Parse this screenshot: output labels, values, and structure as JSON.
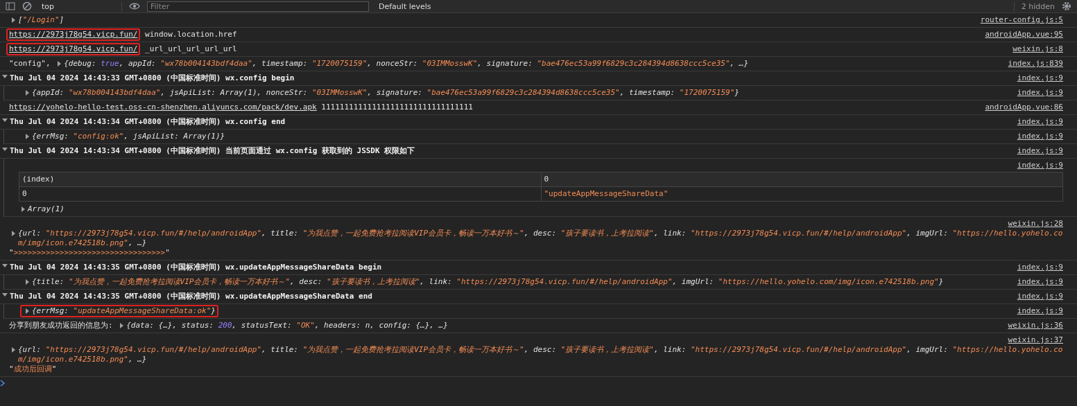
{
  "toolbar": {
    "context": "top",
    "filter_placeholder": "Filter",
    "levels": "Default levels",
    "hidden_count": "2 hidden"
  },
  "messages": [
    {
      "kind": "log",
      "source": "router-config.js:5",
      "lines": [
        [
          {
            "kind": "object",
            "expanded": false,
            "parts": [
              {
                "kind": "plain",
                "text": "["
              },
              {
                "kind": "string",
                "text": "\"/Login\""
              },
              {
                "kind": "plain",
                "text": "]"
              }
            ]
          }
        ]
      ]
    },
    {
      "kind": "log",
      "source": "androidApp.vue:95",
      "lines": [
        [
          {
            "kind": "link",
            "text": "https://2973j78g54.vicp.fun/",
            "boxed": true
          },
          {
            "kind": "text",
            "text": " window.location.href"
          }
        ]
      ]
    },
    {
      "kind": "log",
      "source": "weixin.js:8",
      "lines": [
        [
          {
            "kind": "link",
            "text": "https://2973j78g54.vicp.fun/",
            "boxed": true
          },
          {
            "kind": "text",
            "text": " _url_url_url_url_url"
          }
        ]
      ]
    },
    {
      "kind": "log",
      "source": "index.js:839",
      "lines": [
        [
          {
            "kind": "text",
            "text": "\"config\", "
          },
          {
            "kind": "object",
            "expanded": false,
            "parts": [
              {
                "kind": "plain",
                "text": "{debug: "
              },
              {
                "kind": "keyword",
                "text": "true"
              },
              {
                "kind": "plain",
                "text": ", appId: "
              },
              {
                "kind": "string",
                "text": "\"wx78b004143bdf4daa\""
              },
              {
                "kind": "plain",
                "text": ", timestamp: "
              },
              {
                "kind": "string",
                "text": "\"1720075159\""
              },
              {
                "kind": "plain",
                "text": ", nonceStr: "
              },
              {
                "kind": "string",
                "text": "\"03IMMosswK\""
              },
              {
                "kind": "plain",
                "text": ", signature: "
              },
              {
                "kind": "string",
                "text": "\"bae476ec53a99f6829c3c284394d8638ccc5ce35\""
              },
              {
                "kind": "plain",
                "text": ", …}"
              }
            ]
          }
        ]
      ]
    },
    {
      "kind": "group",
      "source": "index.js:9",
      "expanded": true,
      "title": "Thu Jul 04 2024 14:43:33 GMT+0800 (中国标准时间) wx.config begin",
      "children": [
        {
          "kind": "log",
          "source": "index.js:9",
          "lines": [
            [
              {
                "kind": "object",
                "expanded": false,
                "parts": [
                  {
                    "kind": "plain",
                    "text": "{appId: "
                  },
                  {
                    "kind": "string",
                    "text": "\"wx78b004143bdf4daa\""
                  },
                  {
                    "kind": "plain",
                    "text": ", jsApiList: Array(1), nonceStr: "
                  },
                  {
                    "kind": "string",
                    "text": "\"03IMMosswK\""
                  },
                  {
                    "kind": "plain",
                    "text": ", signature: "
                  },
                  {
                    "kind": "string",
                    "text": "\"bae476ec53a99f6829c3c284394d8638ccc5ce35\""
                  },
                  {
                    "kind": "plain",
                    "text": ", timestamp: "
                  },
                  {
                    "kind": "string",
                    "text": "\"1720075159\""
                  },
                  {
                    "kind": "plain",
                    "text": "}"
                  }
                ]
              }
            ]
          ]
        }
      ]
    },
    {
      "kind": "log",
      "source": "androidApp.vue:86",
      "lines": [
        [
          {
            "kind": "link",
            "text": "https://yohelo-hello-test.oss-cn-shenzhen.aliyuncs.com/pack/dev.apk"
          },
          {
            "kind": "text",
            "text": " 111111111111111111111111111111111"
          }
        ]
      ]
    },
    {
      "kind": "group",
      "source": "index.js:9",
      "expanded": true,
      "title": "Thu Jul 04 2024 14:43:34 GMT+0800 (中国标准时间) wx.config end",
      "children": [
        {
          "kind": "log",
          "source": "index.js:9",
          "lines": [
            [
              {
                "kind": "object",
                "expanded": false,
                "parts": [
                  {
                    "kind": "plain",
                    "text": "{errMsg: "
                  },
                  {
                    "kind": "string",
                    "text": "\"config:ok\""
                  },
                  {
                    "kind": "plain",
                    "text": ", jsApiList: Array(1)}"
                  }
                ]
              }
            ]
          ]
        }
      ]
    },
    {
      "kind": "group",
      "source": "index.js:9",
      "expanded": true,
      "title": "Thu Jul 04 2024 14:43:34 GMT+0800 (中国标准时间) 当前页面通过 wx.config 获取到的 JSSDK 权限如下",
      "children": [
        {
          "kind": "table",
          "source": "index.js:9",
          "columns": [
            "(index)",
            "0"
          ],
          "rows": [
            [
              "0",
              "\"updateAppMessageShareData\""
            ]
          ],
          "footer": [
            {
              "kind": "object",
              "expanded": false,
              "parts": [
                {
                  "kind": "plain",
                  "text": "Array(1)"
                }
              ]
            }
          ]
        }
      ]
    },
    {
      "kind": "block",
      "source": "weixin.js:28",
      "lines": [
        [
          {
            "kind": "object",
            "expanded": false,
            "parts": [
              {
                "kind": "plain",
                "text": "{url: "
              },
              {
                "kind": "string",
                "text": "\"https://2973j78g54.vicp.fun/#/help/androidApp\""
              },
              {
                "kind": "plain",
                "text": ", title: "
              },
              {
                "kind": "string",
                "text": "\"为我点赞，一起免费抢考拉阅读VIP会员卡，畅读一万本好书～\""
              },
              {
                "kind": "plain",
                "text": ", desc: "
              },
              {
                "kind": "string",
                "text": "\"孩子要读书，上考拉阅读\""
              },
              {
                "kind": "plain",
                "text": ", link: "
              },
              {
                "kind": "string",
                "text": "\"https://2973j78g54.vicp.fun/#/help/androidApp\""
              },
              {
                "kind": "plain",
                "text": ", imgUrl: "
              },
              {
                "kind": "string",
                "text": "\"https://hello.yohelo.com/img/icon.e742518b.png\""
              },
              {
                "kind": "plain",
                "text": ", …}"
              }
            ]
          }
        ],
        [
          {
            "kind": "text",
            "parts": [
              {
                "kind": "plain",
                "text": "\""
              },
              {
                "kind": "string",
                "text": ">>>>>>>>>>>>>>>>>>>>>>>>>>>>>>>>>"
              },
              {
                "kind": "plain",
                "text": "\""
              }
            ]
          }
        ]
      ]
    },
    {
      "kind": "group",
      "source": "index.js:9",
      "expanded": true,
      "title": "Thu Jul 04 2024 14:43:35 GMT+0800 (中国标准时间) wx.updateAppMessageShareData begin",
      "children": [
        {
          "kind": "log",
          "source": "index.js:9",
          "lines": [
            [
              {
                "kind": "object",
                "expanded": false,
                "parts": [
                  {
                    "kind": "plain",
                    "text": "{title: "
                  },
                  {
                    "kind": "string",
                    "text": "\"为我点赞，一起免费抢考拉阅读VIP会员卡，畅读一万本好书～\""
                  },
                  {
                    "kind": "plain",
                    "text": ", desc: "
                  },
                  {
                    "kind": "string",
                    "text": "\"孩子要读书，上考拉阅读\""
                  },
                  {
                    "kind": "plain",
                    "text": ", link: "
                  },
                  {
                    "kind": "string",
                    "text": "\"https://2973j78g54.vicp.fun/#/help/androidApp\""
                  },
                  {
                    "kind": "plain",
                    "text": ", imgUrl: "
                  },
                  {
                    "kind": "string",
                    "text": "\"https://hello.yohelo.com/img/icon.e742518b.png\""
                  },
                  {
                    "kind": "plain",
                    "text": "}"
                  }
                ]
              }
            ]
          ]
        }
      ]
    },
    {
      "kind": "group",
      "source": "index.js:9",
      "expanded": true,
      "title": "Thu Jul 04 2024 14:43:35 GMT+0800 (中国标准时间) wx.updateAppMessageShareData end",
      "children": [
        {
          "kind": "log",
          "source": "index.js:9",
          "lines": [
            [
              {
                "kind": "object",
                "expanded": false,
                "boxed": true,
                "parts": [
                  {
                    "kind": "plain",
                    "text": "{errMsg: "
                  },
                  {
                    "kind": "string",
                    "text": "\"updateAppMessageShareData:ok\""
                  },
                  {
                    "kind": "plain",
                    "text": "}"
                  }
                ]
              }
            ]
          ]
        }
      ]
    },
    {
      "kind": "log",
      "source": "weixin.js:36",
      "lines": [
        [
          {
            "kind": "text",
            "text": "分享到朋友成功返回的信息为: "
          },
          {
            "kind": "object",
            "expanded": false,
            "parts": [
              {
                "kind": "plain",
                "text": "{data: {…}, status: "
              },
              {
                "kind": "keyword",
                "text": "200"
              },
              {
                "kind": "plain",
                "text": ", statusText: "
              },
              {
                "kind": "string",
                "text": "\"OK\""
              },
              {
                "kind": "plain",
                "text": ", headers: n, config: {…}, …}"
              }
            ]
          }
        ]
      ]
    },
    {
      "kind": "block",
      "source": "weixin.js:37",
      "lines": [
        [
          {
            "kind": "object",
            "expanded": false,
            "parts": [
              {
                "kind": "plain",
                "text": "{url: "
              },
              {
                "kind": "string",
                "text": "\"https://2973j78g54.vicp.fun/#/help/androidApp\""
              },
              {
                "kind": "plain",
                "text": ", title: "
              },
              {
                "kind": "string",
                "text": "\"为我点赞，一起免费抢考拉阅读VIP会员卡，畅读一万本好书～\""
              },
              {
                "kind": "plain",
                "text": ", desc: "
              },
              {
                "kind": "string",
                "text": "\"孩子要读书，上考拉阅读\""
              },
              {
                "kind": "plain",
                "text": ", link: "
              },
              {
                "kind": "string",
                "text": "\"https://2973j78g54.vicp.fun/#/help/androidApp\""
              },
              {
                "kind": "plain",
                "text": ", imgUrl: "
              },
              {
                "kind": "string",
                "text": "\"https://hello.yohelo.com/img/icon.e742518b.png\""
              },
              {
                "kind": "plain",
                "text": ", …}"
              }
            ]
          }
        ],
        [
          {
            "kind": "text",
            "parts": [
              {
                "kind": "plain",
                "text": "\""
              },
              {
                "kind": "string",
                "text": "成功后回调"
              },
              {
                "kind": "plain",
                "text": "\""
              }
            ]
          }
        ]
      ]
    }
  ]
}
